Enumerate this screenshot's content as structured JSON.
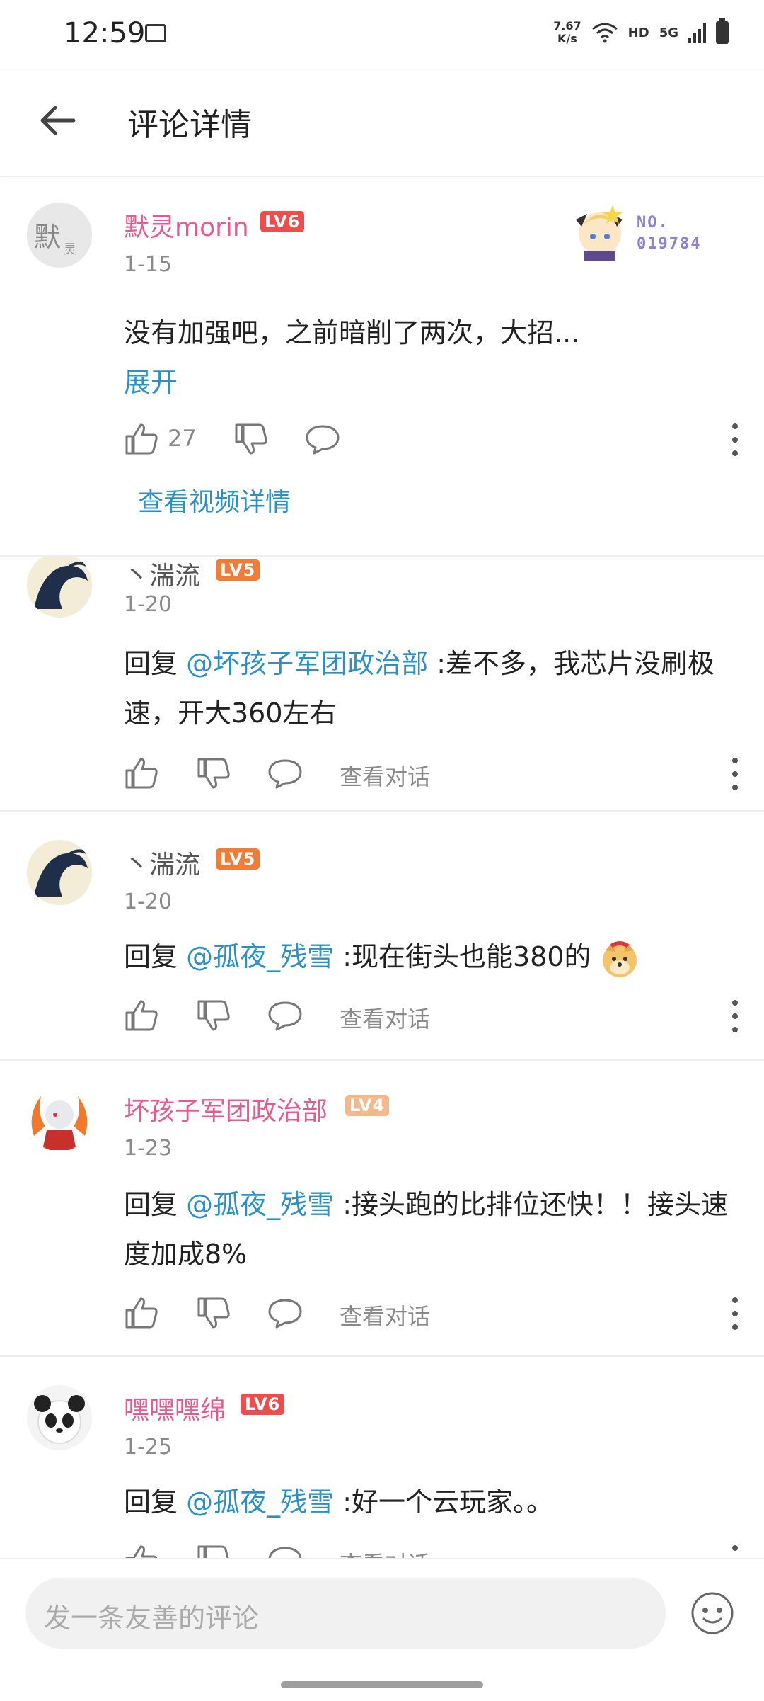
{
  "status": {
    "time": "12:59",
    "speed_top": "7.67",
    "speed_bottom": "K/s",
    "hd": "HD",
    "net": "5G"
  },
  "header": {
    "title": "评论详情"
  },
  "root_comment": {
    "username": "默灵morin",
    "level": "LV6",
    "date": "1-15",
    "text": "没有加强吧，之前暗削了两次，大招...",
    "expand": "展开",
    "likes": "27",
    "badge_no": "NO.",
    "badge_num": "019784",
    "video_link": "查看视频详情"
  },
  "replies": [
    {
      "username": "丶湍流",
      "level": "LV5",
      "date": "1-20",
      "prefix": "回复 ",
      "mention": "@坏孩子军团政治部",
      "text": " :差不多，我芯片没刷极速，开大360左右",
      "view_conv": "查看对话"
    },
    {
      "username": "丶湍流",
      "level": "LV5",
      "date": "1-20",
      "prefix": "回复 ",
      "mention": "@孤夜_残雪",
      "text": " :现在街头也能380的",
      "view_conv": "查看对话"
    },
    {
      "username": "坏孩子军团政治部",
      "level": "LV4",
      "date": "1-23",
      "prefix": "回复 ",
      "mention": "@孤夜_残雪",
      "text": " :接头跑的比排位还快！！接头速度加成8%",
      "view_conv": "查看对话"
    },
    {
      "username": "嘿嘿嘿绵",
      "level": "LV6",
      "date": "1-25",
      "prefix": "回复 ",
      "mention": "@孤夜_残雪",
      "text": " :好一个云玩家。。",
      "view_conv": "查看对话"
    }
  ],
  "composer": {
    "placeholder": "发一条友善的评论"
  },
  "colors": {
    "accent": "#2b8fc8",
    "username_pink": "#e85a8f",
    "lv6": "#f04c4c",
    "lv5": "#f07c38",
    "lv4": "#f5b88a"
  }
}
